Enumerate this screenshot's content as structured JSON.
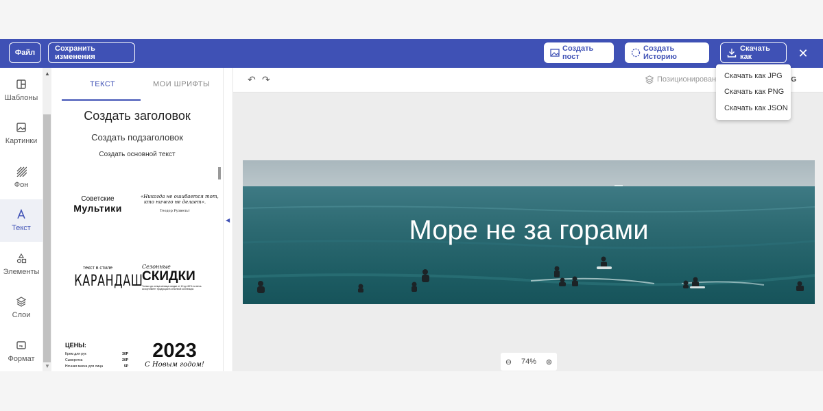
{
  "colors": {
    "accent": "#3f51b5",
    "topbar": "#3f51b5",
    "panel_bg": "#ffffff",
    "canvas_bg": "#ededed"
  },
  "topbar": {
    "file_label": "Файл",
    "save_label": "Сохранить изменения",
    "create_post_label": "Создать пост",
    "create_story_label": "Создать Историю",
    "download_label": "Скачать как",
    "close_icon": "close-icon"
  },
  "download_menu": {
    "items": [
      "Скачать как JPG",
      "Скачать как PNG",
      "Скачать как JSON"
    ]
  },
  "sidebar": {
    "items": [
      {
        "label": "Шаблоны",
        "icon": "templates-icon"
      },
      {
        "label": "Картинки",
        "icon": "image-icon"
      },
      {
        "label": "Фон",
        "icon": "background-icon"
      },
      {
        "label": "Текст",
        "icon": "text-icon"
      },
      {
        "label": "Элементы",
        "icon": "shapes-icon"
      },
      {
        "label": "Слои",
        "icon": "layers-icon"
      },
      {
        "label": "Формат",
        "icon": "format-icon"
      }
    ],
    "active": "Текст"
  },
  "text_panel": {
    "tabs": [
      "ТЕКСТ",
      "МОИ ШРИФТЫ"
    ],
    "heading": "Создать заголовок",
    "subheading": "Создать подзаголовок",
    "body": "Создать основной текст",
    "templates": {
      "multiki": {
        "line1": "Советские",
        "line2": "Мультики"
      },
      "quote": {
        "line1": "«Никогда не ошибается тот,",
        "line2": "кто ничего не делает».",
        "author": "Теодор Рузвельт"
      },
      "karandash": {
        "line1": "текст в стиле",
        "line2": "КАРАНДАШ"
      },
      "skidki": {
        "line1": "Сезонные",
        "line2": "СКИДКИ",
        "fine": "Только до конца месяца скидки от 10 до 60% на весь ассортимент продукции в сезонной коллекции."
      },
      "prices": {
        "title": "ЦЕНЫ:",
        "rows": [
          {
            "name": "Крем для рук",
            "price": "30Р"
          },
          {
            "name": "Сыворотка",
            "price": "20Р"
          },
          {
            "name": "Ночная маска для лица",
            "price": "5Р"
          }
        ]
      },
      "newyear": {
        "year": "2023",
        "greeting": "С Новым годом!"
      }
    }
  },
  "canvas_toolbar": {
    "positioning_label": "Позиционирование",
    "svg_label": "SVG"
  },
  "canvas": {
    "banner_title": "Море не за горами"
  },
  "zoom": {
    "value": "74%"
  }
}
